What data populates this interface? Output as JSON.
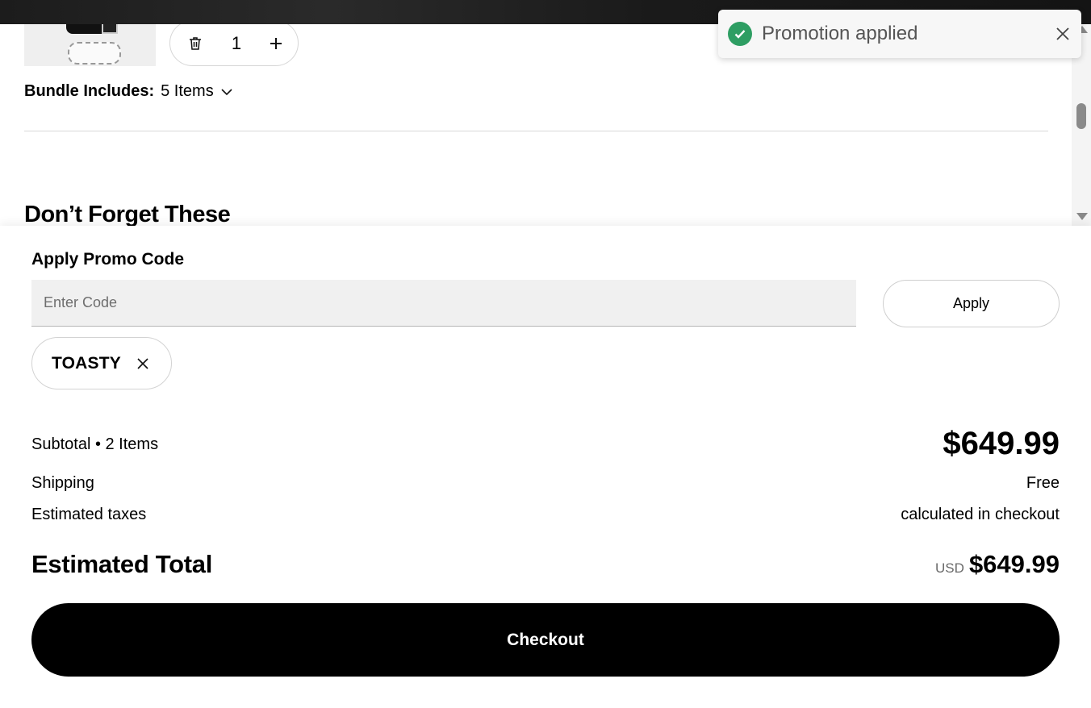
{
  "cart_item": {
    "quantity": "1",
    "bundle_label": "Bundle Includes:",
    "bundle_count": "5 Items"
  },
  "recommendations": {
    "heading": "Don’t Forget These"
  },
  "promo": {
    "title": "Apply Promo Code",
    "input_placeholder": "Enter Code",
    "input_value": "",
    "apply_label": "Apply",
    "applied_code": "TOASTY"
  },
  "summary": {
    "subtotal_label": "Subtotal • 2 Items",
    "subtotal_value": "$649.99",
    "shipping_label": "Shipping",
    "shipping_value": "Free",
    "taxes_label": "Estimated taxes",
    "taxes_value": "calculated in checkout",
    "total_label": "Estimated Total",
    "total_currency": "USD",
    "total_value": "$649.99"
  },
  "checkout": {
    "label": "Checkout"
  },
  "toast": {
    "message": "Promotion applied",
    "status_color": "#2e9e63"
  },
  "icons": {
    "trash": "trash-icon",
    "plus": "plus-icon",
    "chevron": "chevron-down-icon",
    "close": "close-icon",
    "check": "check-circle-icon"
  }
}
